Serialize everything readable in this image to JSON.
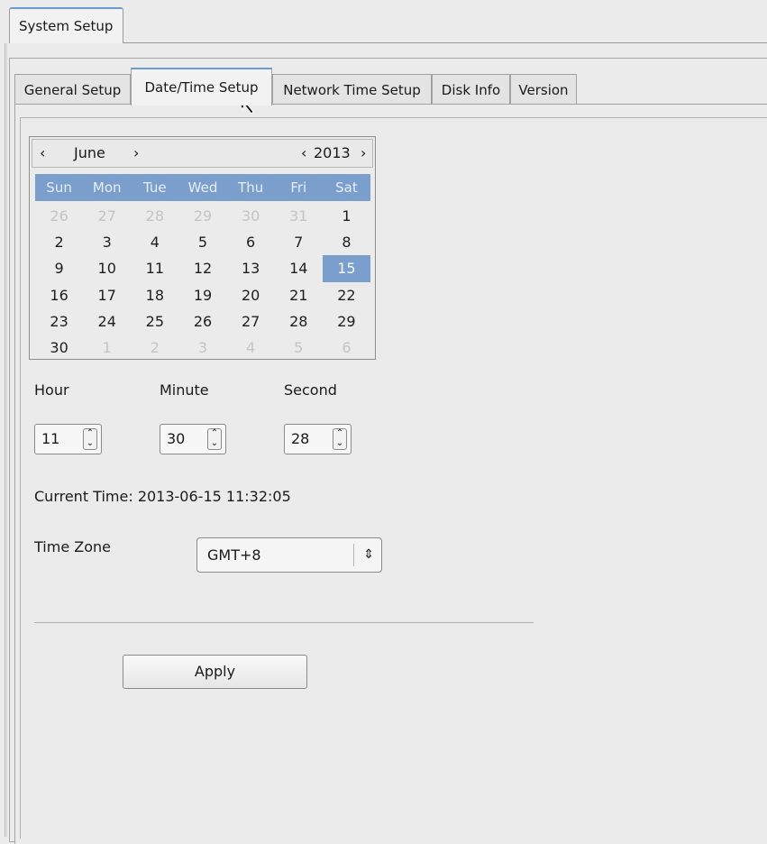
{
  "outer_tab": {
    "label": "System Setup"
  },
  "tabs": [
    {
      "label": "General Setup"
    },
    {
      "label": "Date/Time Setup"
    },
    {
      "label": "Network Time Setup"
    },
    {
      "label": "Disk Info"
    },
    {
      "label": "Version"
    }
  ],
  "calendar": {
    "prev_month": "‹",
    "month": "June",
    "next_month": "›",
    "prev_year": "‹",
    "year": "2013",
    "next_year": "›",
    "weekdays": [
      "Sun",
      "Mon",
      "Tue",
      "Wed",
      "Thu",
      "Fri",
      "Sat"
    ],
    "weeks": [
      [
        "26",
        "27",
        "28",
        "29",
        "30",
        "31",
        "1"
      ],
      [
        "2",
        "3",
        "4",
        "5",
        "6",
        "7",
        "8"
      ],
      [
        "9",
        "10",
        "11",
        "12",
        "13",
        "14",
        "15"
      ],
      [
        "16",
        "17",
        "18",
        "19",
        "20",
        "21",
        "22"
      ],
      [
        "23",
        "24",
        "25",
        "26",
        "27",
        "28",
        "29"
      ],
      [
        "30",
        "1",
        "2",
        "3",
        "4",
        "5",
        "6"
      ]
    ],
    "selected_day": "15"
  },
  "time": {
    "hour_label": "Hour",
    "minute_label": "Minute",
    "second_label": "Second",
    "hour": "11",
    "minute": "30",
    "second": "28"
  },
  "current_time": "Current Time: 2013-06-15 11:32:05",
  "timezone": {
    "label": "Time Zone",
    "value": "GMT+8"
  },
  "apply_label": "Apply",
  "colors": {
    "accent": "#7b9fcc",
    "tab_highlight": "#6b9bd1"
  }
}
